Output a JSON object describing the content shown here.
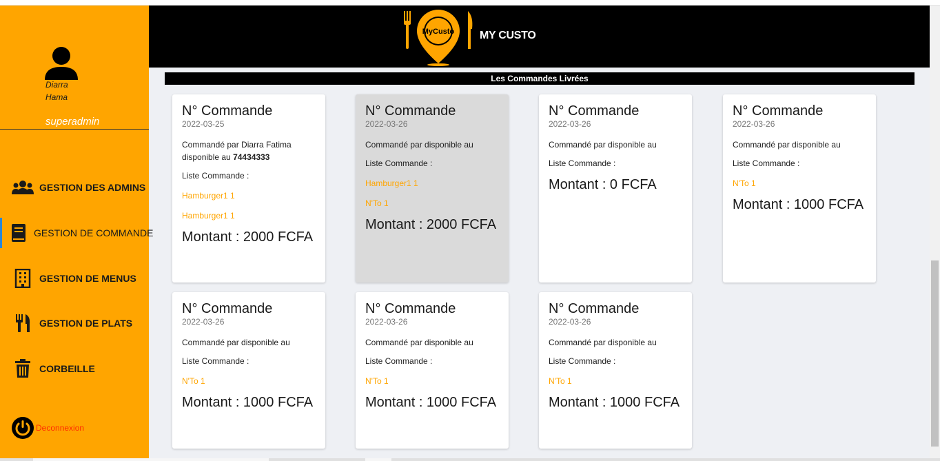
{
  "user": {
    "first_name": "Diarra",
    "last_name": "Hama",
    "role": "superadmin"
  },
  "nav": [
    {
      "label": "GESTION DES ADMINS",
      "icon": "users-icon"
    },
    {
      "label": "GESTION DE COMMANDE",
      "icon": "book-icon"
    },
    {
      "label": "GESTION DE MENUS",
      "icon": "building-icon"
    },
    {
      "label": "GESTION DE PLATS",
      "icon": "utensils-icon"
    },
    {
      "label": "CORBEILLE",
      "icon": "trash-icon"
    }
  ],
  "logout": {
    "label": "Deconnexion",
    "icon": "power-icon"
  },
  "header": {
    "logo_text": "MyCusto",
    "brand": "MY CUSTO"
  },
  "section_title": "Les Commandes Livrées",
  "cards": [
    {
      "title": "N° Commande",
      "date": "2022-03-25",
      "ordered_by": "Commandé par Diarra Fatima disponible au",
      "phone": "74434333",
      "list_label": "Liste Commande :",
      "items": [
        "Hamburger1 1",
        "Hamburger1 1"
      ],
      "amount": "Montant : 2000 FCFA"
    },
    {
      "title": "N° Commande",
      "date": "2022-03-26",
      "ordered_by": "Commandé par disponible au",
      "phone": "",
      "list_label": "Liste Commande :",
      "items": [
        "Hamburger1 1",
        "N'To 1"
      ],
      "amount": "Montant : 2000 FCFA"
    },
    {
      "title": "N° Commande",
      "date": "2022-03-26",
      "ordered_by": "Commandé par disponible au",
      "phone": "",
      "list_label": "Liste Commande :",
      "items": [],
      "amount": "Montant : 0 FCFA"
    },
    {
      "title": "N° Commande",
      "date": "2022-03-26",
      "ordered_by": "Commandé par disponible au",
      "phone": "",
      "list_label": "Liste Commande :",
      "items": [
        "N'To 1"
      ],
      "amount": "Montant : 1000 FCFA"
    },
    {
      "title": "N° Commande",
      "date": "2022-03-26",
      "ordered_by": "Commandé par disponible au",
      "phone": "",
      "list_label": "Liste Commande :",
      "items": [
        "N'To 1"
      ],
      "amount": "Montant : 1000 FCFA"
    },
    {
      "title": "N° Commande",
      "date": "2022-03-26",
      "ordered_by": "Commandé par disponible au",
      "phone": "",
      "list_label": "Liste Commande :",
      "items": [
        "N'To 1"
      ],
      "amount": "Montant : 1000 FCFA"
    },
    {
      "title": "N° Commande",
      "date": "2022-03-26",
      "ordered_by": "Commandé par disponible au",
      "phone": "",
      "list_label": "Liste Commande :",
      "items": [
        "N'To 1"
      ],
      "amount": "Montant : 1000 FCFA"
    }
  ],
  "colors": {
    "sidebar": "#ffa500",
    "header": "#000000",
    "accent_item": "#ffa500",
    "logout": "#ff2a00",
    "selected_card": "#dadada"
  }
}
